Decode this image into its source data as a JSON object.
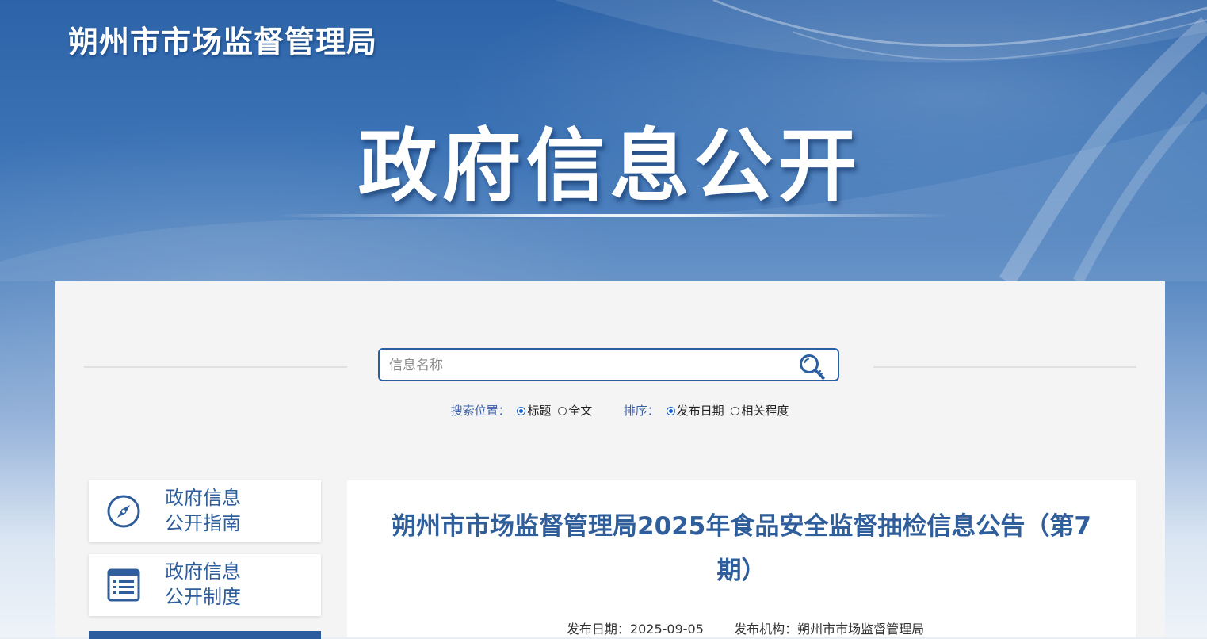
{
  "header": {
    "site_name": "朔州市市场监督管理局",
    "banner_title": "政府信息公开"
  },
  "search": {
    "placeholder": "信息名称",
    "scope_label": "搜索位置：",
    "scope_options": [
      "标题",
      "全文"
    ],
    "scope_selected": "标题",
    "sort_label": "排序：",
    "sort_options": [
      "发布日期",
      "相关程度"
    ],
    "sort_selected": "发布日期"
  },
  "sidebar": {
    "items": [
      {
        "line1": "政府信息",
        "line2": "公开指南",
        "icon": "compass-icon"
      },
      {
        "line1": "政府信息",
        "line2": "公开制度",
        "icon": "document-list-icon"
      }
    ]
  },
  "article": {
    "title": "朔州市市场监督管理局2025年食品安全监督抽检信息公告（第7期）",
    "date_label": "发布日期：",
    "date": "2025-09-05",
    "org_label": "发布机构：",
    "org": "朔州市市场监督管理局"
  },
  "colors": {
    "primary": "#2f5e9b",
    "search_border": "#2b5fa1",
    "panel_bg": "#f4f4f4"
  }
}
